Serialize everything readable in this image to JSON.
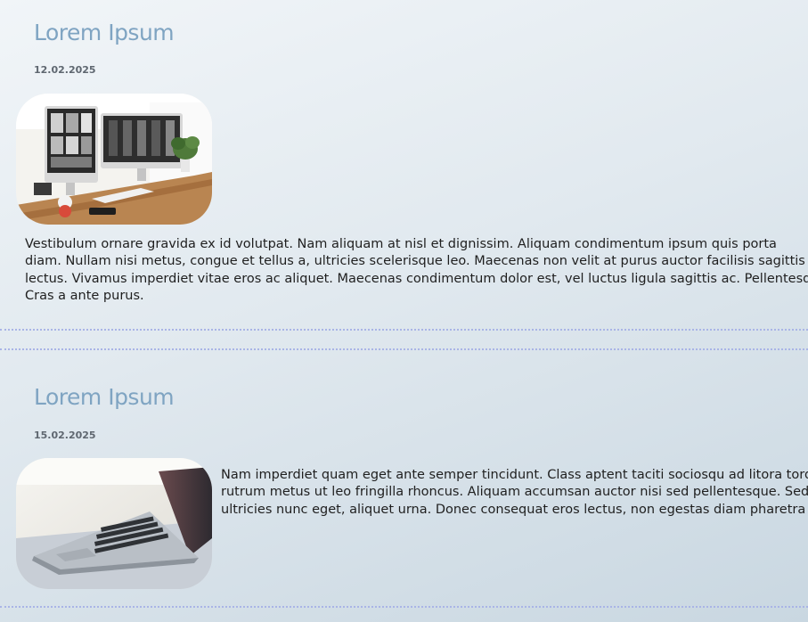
{
  "posts": [
    {
      "title": "Lorem Ipsum",
      "date": "12.02.2025",
      "image_icon": "desktop-computers-photo",
      "body_lines": [
        "Vestibulum ornare gravida ex id volutpat. Nam aliquam at nisl et dignissim. Aliquam condimentum ipsum quis porta",
        "diam. Nullam nisi metus, congue et tellus a, ultricies scelerisque leo. Maecenas non velit at purus auctor facilisis sagittis",
        "lectus. Vivamus imperdiet vitae eros ac aliquet. Maecenas condimentum dolor est, vel luctus ligula sagittis ac. Pellentesque",
        "Cras a ante purus."
      ]
    },
    {
      "title": "Lorem Ipsum",
      "date": "15.02.2025",
      "image_icon": "laptop-photo",
      "body_lines": [
        "Nam imperdiet quam eget ante semper tincidunt. Class aptent taciti sociosqu ad litora torquent",
        "rutrum metus ut leo fringilla rhoncus. Aliquam accumsan auctor nisi sed pellentesque. Sed",
        "ultricies nunc eget, aliquet urna. Donec consequat eros lectus, non egestas diam pharetra"
      ]
    }
  ],
  "colors": {
    "title": "#7fa4c2",
    "divider": "#a9b4e6"
  }
}
